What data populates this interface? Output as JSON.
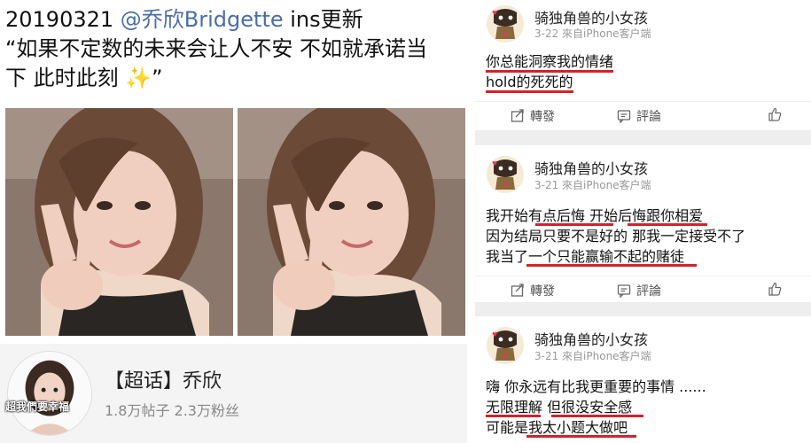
{
  "left_post": {
    "line1_prefix": "20190321 ",
    "mention": "@乔欣Bridgette",
    "line1_suffix": " ins更新",
    "line2": "“如果不定数的未来会让人不安 不如就承诺当",
    "line3_text": "下 此时此刻 ",
    "line3_emoji": "✨",
    "line3_end": "”"
  },
  "topic_card": {
    "name": "【超话】乔欣",
    "stats": "1.8万帖子 2.3万粉丝",
    "avatar_overlay": "超我們要幸福"
  },
  "comments": [
    {
      "username": "骑独角兽的小女孩",
      "meta": "3-22  來自iPhone客户端",
      "lines": [
        "你总能洞察我的情绪",
        "hold的死死的"
      ]
    },
    {
      "username": "骑独角兽的小女孩",
      "meta": "3-21  來自iPhone客户端",
      "lines": [
        "我开始有点后悔 开始后悔跟你相爱",
        "因为结局只要不是好的 那我一定接受不了",
        "我当了一个只能赢输不起的赌徒"
      ]
    },
    {
      "username": "骑独角兽的小女孩",
      "meta": "3-21  來自iPhone客户端",
      "lines": [
        "嗨 你永远有比我更重要的事情 ......",
        "无限理解 但很没安全感",
        "可能是我太小题大做吧"
      ]
    }
  ],
  "actions": {
    "repost": "轉發",
    "comment": "評論"
  },
  "colors": {
    "mention": "#4a6da8",
    "underline": "#d2232a",
    "background_gray": "#eeeeee"
  },
  "icons": [
    "repost-icon",
    "comment-icon",
    "like-icon",
    "avatar-sticker-icon"
  ]
}
